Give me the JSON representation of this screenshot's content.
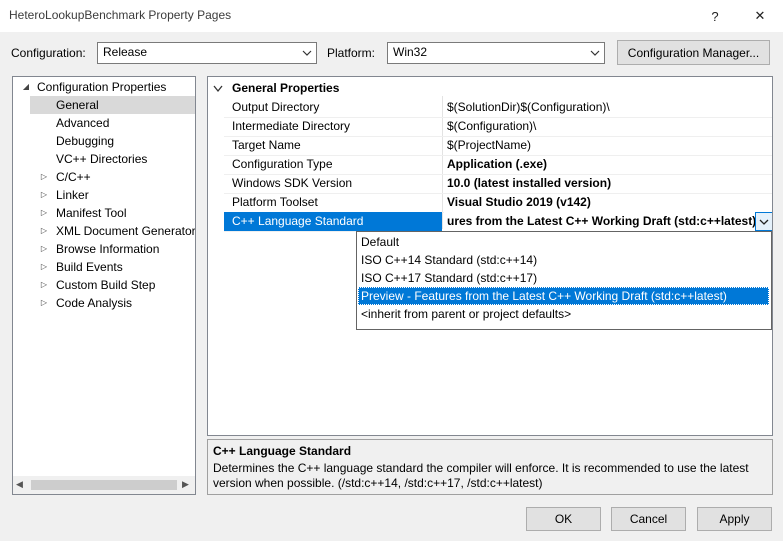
{
  "window": {
    "title": "HeteroLookupBenchmark Property Pages",
    "help_glyph": "?",
    "close_glyph": "✕"
  },
  "config_bar": {
    "configuration_label": "Configuration:",
    "configuration_value": "Release",
    "platform_label": "Platform:",
    "platform_value": "Win32",
    "manager_button": "Configuration Manager..."
  },
  "tree": {
    "root": "Configuration Properties",
    "items": [
      {
        "label": "General",
        "expandable": false,
        "selected": true
      },
      {
        "label": "Advanced",
        "expandable": false
      },
      {
        "label": "Debugging",
        "expandable": false
      },
      {
        "label": "VC++ Directories",
        "expandable": false
      },
      {
        "label": "C/C++",
        "expandable": true
      },
      {
        "label": "Linker",
        "expandable": true
      },
      {
        "label": "Manifest Tool",
        "expandable": true
      },
      {
        "label": "XML Document Generator",
        "expandable": true
      },
      {
        "label": "Browse Information",
        "expandable": true
      },
      {
        "label": "Build Events",
        "expandable": true
      },
      {
        "label": "Custom Build Step",
        "expandable": true
      },
      {
        "label": "Code Analysis",
        "expandable": true
      }
    ]
  },
  "grid": {
    "category": "General Properties",
    "rows": [
      {
        "name": "Output Directory",
        "value": "$(SolutionDir)$(Configuration)\\",
        "bold": false
      },
      {
        "name": "Intermediate Directory",
        "value": "$(Configuration)\\",
        "bold": false
      },
      {
        "name": "Target Name",
        "value": "$(ProjectName)",
        "bold": false
      },
      {
        "name": "Configuration Type",
        "value": "Application (.exe)",
        "bold": true
      },
      {
        "name": "Windows SDK Version",
        "value": "10.0 (latest installed version)",
        "bold": true
      },
      {
        "name": "Platform Toolset",
        "value": "Visual Studio 2019 (v142)",
        "bold": true
      },
      {
        "name": "C++ Language Standard",
        "value": "ures from the Latest C++ Working Draft (std:c++latest)",
        "bold": true,
        "selected": true
      }
    ]
  },
  "dropdown": {
    "options": [
      "Default",
      "ISO C++14 Standard (std:c++14)",
      "ISO C++17 Standard (std:c++17)",
      "Preview - Features from the Latest C++ Working Draft (std:c++latest)",
      "<inherit from parent or project defaults>"
    ],
    "selected_index": 3
  },
  "description": {
    "title": "C++ Language Standard",
    "text": "Determines the C++ language standard the compiler will enforce. It is recommended to use the latest version when possible.  (/std:c++14, /std:c++17, /std:c++latest)"
  },
  "buttons": {
    "ok": "OK",
    "cancel": "Cancel",
    "apply": "Apply"
  },
  "colors": {
    "selection_blue": "#0078d7",
    "tree_selection_gray": "#d9d9d9",
    "window_bg": "#f0f0f0"
  }
}
